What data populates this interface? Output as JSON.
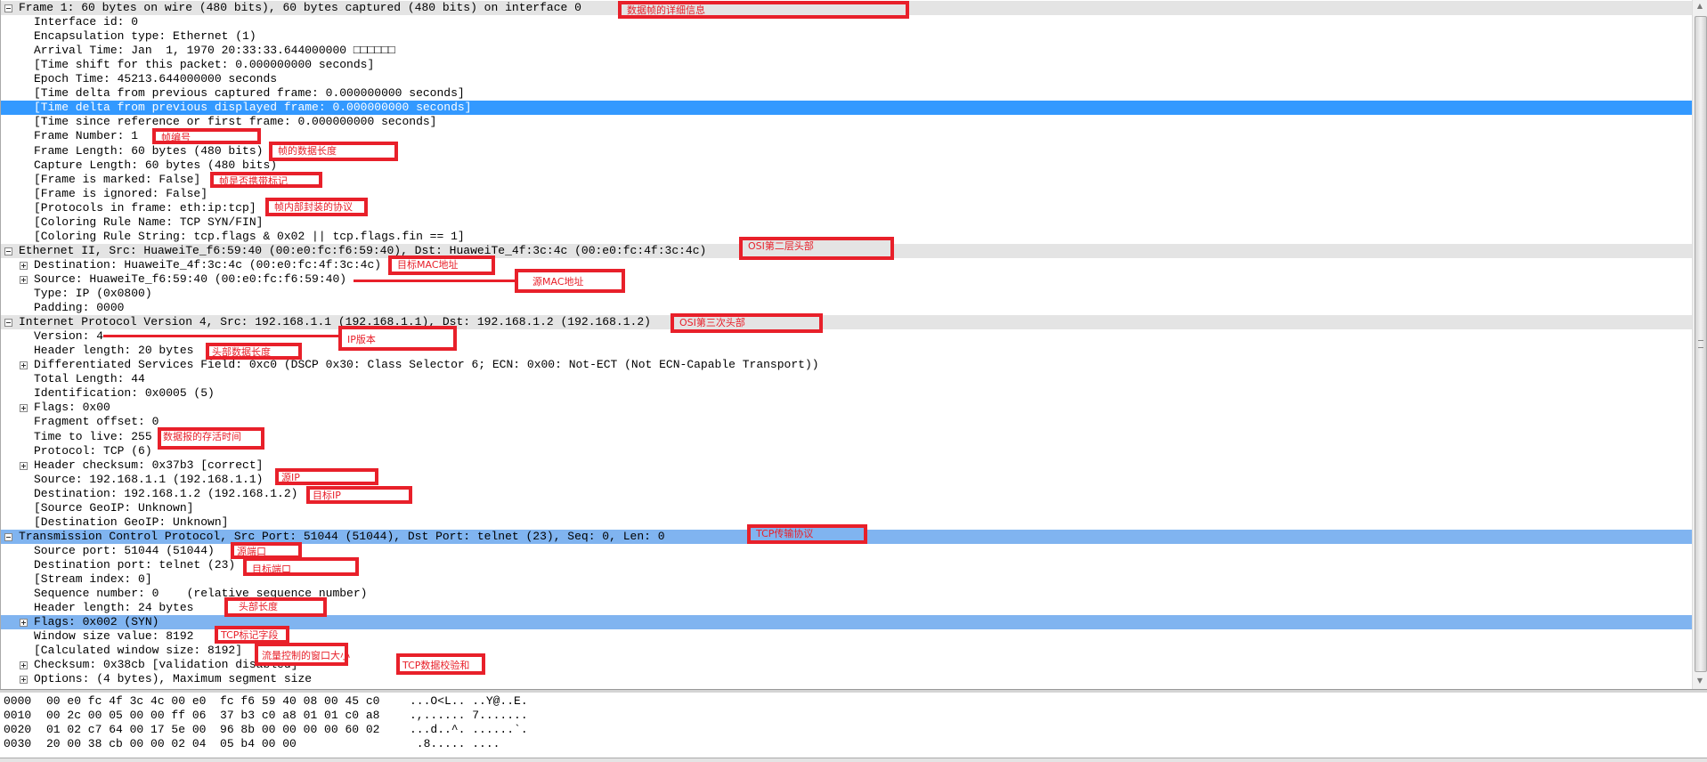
{
  "colors": {
    "header_row": "#e4e4e4",
    "selected_row": "#3399ff",
    "tcp_highlight": "#80b4f0",
    "annotation_red": "#e8202a"
  },
  "tree": [
    {
      "text": "Frame 1: 60 bytes on wire (480 bits), 60 bytes captured (480 bits) on interface 0",
      "exp": "minus",
      "level": 0,
      "style": "hdr"
    },
    {
      "text": "Interface id: 0",
      "level": 1
    },
    {
      "text": "Encapsulation type: Ethernet (1)",
      "level": 1
    },
    {
      "text": "Arrival Time: Jan  1, 1970 20:33:33.644000000 □□□□□□",
      "level": 1
    },
    {
      "text": "[Time shift for this packet: 0.000000000 seconds]",
      "level": 1
    },
    {
      "text": "Epoch Time: 45213.644000000 seconds",
      "level": 1
    },
    {
      "text": "[Time delta from previous captured frame: 0.000000000 seconds]",
      "level": 1
    },
    {
      "text": "[Time delta from previous displayed frame: 0.000000000 seconds]",
      "level": 1,
      "style": "sel"
    },
    {
      "text": "[Time since reference or first frame: 0.000000000 seconds]",
      "level": 1
    },
    {
      "text": "Frame Number: 1",
      "level": 1
    },
    {
      "text": "Frame Length: 60 bytes (480 bits)",
      "level": 1
    },
    {
      "text": "Capture Length: 60 bytes (480 bits)",
      "level": 1
    },
    {
      "text": "[Frame is marked: False]",
      "level": 1
    },
    {
      "text": "[Frame is ignored: False]",
      "level": 1
    },
    {
      "text": "[Protocols in frame: eth:ip:tcp]",
      "level": 1
    },
    {
      "text": "[Coloring Rule Name: TCP SYN/FIN]",
      "level": 1
    },
    {
      "text": "[Coloring Rule String: tcp.flags & 0x02 || tcp.flags.fin == 1]",
      "level": 1
    },
    {
      "text": "Ethernet II, Src: HuaweiTe_f6:59:40 (00:e0:fc:f6:59:40), Dst: HuaweiTe_4f:3c:4c (00:e0:fc:4f:3c:4c)",
      "exp": "minus",
      "level": 0,
      "style": "hdr"
    },
    {
      "text": "Destination: HuaweiTe_4f:3c:4c (00:e0:fc:4f:3c:4c)",
      "exp": "plus",
      "level": 1
    },
    {
      "text": "Source: HuaweiTe_f6:59:40 (00:e0:fc:f6:59:40)",
      "exp": "plus",
      "level": 1
    },
    {
      "text": "Type: IP (0x0800)",
      "level": 1
    },
    {
      "text": "Padding: 0000",
      "level": 1
    },
    {
      "text": "Internet Protocol Version 4, Src: 192.168.1.1 (192.168.1.1), Dst: 192.168.1.2 (192.168.1.2)",
      "exp": "minus",
      "level": 0,
      "style": "hdr"
    },
    {
      "text": "Version: 4",
      "level": 1
    },
    {
      "text": "Header length: 20 bytes",
      "level": 1
    },
    {
      "text": "Differentiated Services Field: 0xc0 (DSCP 0x30: Class Selector 6; ECN: 0x00: Not-ECT (Not ECN-Capable Transport))",
      "exp": "plus",
      "level": 1
    },
    {
      "text": "Total Length: 44",
      "level": 1
    },
    {
      "text": "Identification: 0x0005 (5)",
      "level": 1
    },
    {
      "text": "Flags: 0x00",
      "exp": "plus",
      "level": 1
    },
    {
      "text": "Fragment offset: 0",
      "level": 1
    },
    {
      "text": "Time to live: 255",
      "level": 1
    },
    {
      "text": "Protocol: TCP (6)",
      "level": 1
    },
    {
      "text": "Header checksum: 0x37b3 [correct]",
      "exp": "plus",
      "level": 1
    },
    {
      "text": "Source: 192.168.1.1 (192.168.1.1)",
      "level": 1
    },
    {
      "text": "Destination: 192.168.1.2 (192.168.1.2)",
      "level": 1
    },
    {
      "text": "[Source GeoIP: Unknown]",
      "level": 1
    },
    {
      "text": "[Destination GeoIP: Unknown]",
      "level": 1
    },
    {
      "text": "Transmission Control Protocol, Src Port: 51044 (51044), Dst Port: telnet (23), Seq: 0, Len: 0",
      "exp": "minus",
      "level": 0,
      "style": "tcp"
    },
    {
      "text": "Source port: 51044 (51044)",
      "level": 1
    },
    {
      "text": "Destination port: telnet (23)",
      "level": 1
    },
    {
      "text": "[Stream index: 0]",
      "level": 1
    },
    {
      "text": "Sequence number: 0    (relative sequence number)",
      "level": 1
    },
    {
      "text": "Header length: 24 bytes",
      "level": 1
    },
    {
      "text": "Flags: 0x002 (SYN)",
      "exp": "plus",
      "level": 1,
      "style": "tcp"
    },
    {
      "text": "Window size value: 8192",
      "level": 1
    },
    {
      "text": "[Calculated window size: 8192]",
      "level": 1
    },
    {
      "text": "Checksum: 0x38cb [validation disabled]",
      "exp": "plus",
      "level": 1
    },
    {
      "text": "Options: (4 bytes), Maximum segment size",
      "exp": "plus",
      "level": 1
    }
  ],
  "hex": [
    {
      "offset": "0000",
      "bytes": "00 e0 fc 4f 3c 4c 00 e0  fc f6 59 40 08 00 45 c0",
      "ascii": "...O<L.. ..Y@..E."
    },
    {
      "offset": "0010",
      "bytes": "00 2c 00 05 00 00 ff 06  37 b3 c0 a8 01 01 c0 a8",
      "ascii": ".,...... 7......."
    },
    {
      "offset": "0020",
      "bytes": "01 02 c7 64 00 17 5e 00  96 8b 00 00 00 00 60 02",
      "ascii": "...d..^. ......`."
    },
    {
      "offset": "0030",
      "bytes": "20 00 38 cb 00 00 02 04  05 b4 00 00",
      "ascii": " .8..... ...."
    }
  ],
  "annotations": [
    "数据帧的详细信息",
    "帧编号",
    "帧的数据长度",
    "帧是否携带标记",
    "帧内部封装的协议",
    "OSI第二层头部",
    "目标MAC地址",
    "源MAC地址",
    "OSI第三次头部",
    "IP版本",
    "头部数据长度",
    "数据报的存活时间",
    "源IP",
    "目标IP",
    "TCP传输协议",
    "源端口",
    "目标端口",
    "头部长度",
    "TCP标记字段",
    "流量控制的窗口大小",
    "TCP数据校验和"
  ]
}
